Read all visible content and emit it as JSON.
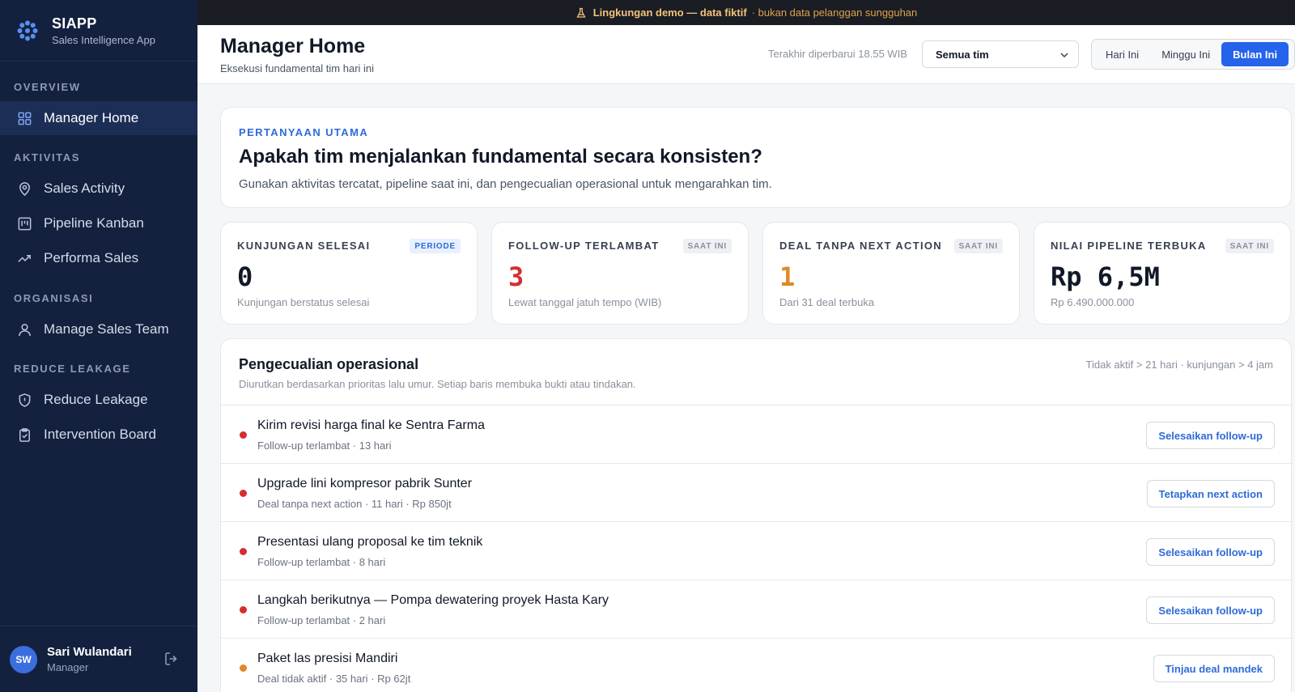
{
  "banner": {
    "strong": "Lingkungan demo — data fiktif",
    "soft": "· bukan data pelanggan sungguhan",
    "icon": "flask-icon",
    "color": "#f4c27a"
  },
  "brand": {
    "name": "SIAPP",
    "subtitle": "Sales Intelligence App",
    "icon": "logo-dots-icon"
  },
  "sidebar": {
    "sections": [
      {
        "title": "OVERVIEW"
      },
      {
        "title": "AKTIVITAS"
      },
      {
        "title": "ORGANISASI"
      },
      {
        "title": "REDUCE LEAKAGE"
      }
    ],
    "items": [
      {
        "label": "Manager Home",
        "icon": "grid-icon",
        "active": true
      },
      {
        "label": "Sales Activity",
        "icon": "map-pin-icon"
      },
      {
        "label": "Pipeline Kanban",
        "icon": "kanban-icon"
      },
      {
        "label": "Performa Sales",
        "icon": "trending-up-icon"
      },
      {
        "label": "Manage Sales Team",
        "icon": "user-icon"
      },
      {
        "label": "Reduce Leakage",
        "icon": "shield-icon"
      },
      {
        "label": "Intervention Board",
        "icon": "clipboard-icon"
      }
    ]
  },
  "user": {
    "initials": "SW",
    "name": "Sari Wulandari",
    "role": "Manager"
  },
  "header": {
    "title": "Manager Home",
    "subtitle": "Eksekusi fundamental tim hari ini",
    "updated": "Terakhir diperbarui 18.55 WIB",
    "team_select": "Semua tim",
    "periods": [
      {
        "label": "Hari Ini",
        "active": false
      },
      {
        "label": "Minggu Ini",
        "active": false
      },
      {
        "label": "Bulan Ini",
        "active": true
      }
    ]
  },
  "question": {
    "eyebrow": "PERTANYAAN UTAMA",
    "title": "Apakah tim menjalankan fundamental secara konsisten?",
    "subtitle": "Gunakan aktivitas tercatat, pipeline saat ini, dan pengecualian operasional untuk mengarahkan tim."
  },
  "kpis": [
    {
      "label": "KUNJUNGAN SELESAI",
      "badge": "PERIODE",
      "value": "0",
      "note": "Kunjungan berstatus selesai",
      "color": "#111827"
    },
    {
      "label": "FOLLOW-UP TERLAMBAT",
      "badge": "SAAT INI",
      "value": "3",
      "note": "Lewat tanggal jatuh tempo (WIB)",
      "color": "#d32f2f"
    },
    {
      "label": "DEAL TANPA NEXT ACTION",
      "badge": "SAAT INI",
      "value": "1",
      "note": "Dari 31 deal terbuka",
      "color": "#e0892a"
    },
    {
      "label": "NILAI PIPELINE TERBUKA",
      "badge": "SAAT INI",
      "value": "Rp 6,5M",
      "note": "Rp 6.490.000.000",
      "color": "#111827"
    }
  ],
  "exceptions": {
    "title": "Pengecualian operasional",
    "subtitle": "Diurutkan berdasarkan prioritas lalu umur. Setiap baris membuka bukti atau tindakan.",
    "filter": "Tidak aktif > 21 hari · kunjungan > 4 jam",
    "rows": [
      {
        "title": "Kirim revisi harga final ke Sentra Farma",
        "meta": "Follow-up terlambat · 13 hari",
        "action": "Selesaikan follow-up",
        "color": "#d32f2f"
      },
      {
        "title": "Upgrade lini kompresor pabrik Sunter",
        "meta": "Deal tanpa next action · 11 hari · Rp 850jt",
        "action": "Tetapkan next action",
        "color": "#d32f2f"
      },
      {
        "title": "Presentasi ulang proposal ke tim teknik",
        "meta": "Follow-up terlambat · 8 hari",
        "action": "Selesaikan follow-up",
        "color": "#d32f2f"
      },
      {
        "title": "Langkah berikutnya — Pompa dewatering proyek Hasta Kary",
        "meta": "Follow-up terlambat · 2 hari",
        "action": "Selesaikan follow-up",
        "color": "#d32f2f"
      },
      {
        "title": "Paket las presisi Mandiri",
        "meta": "Deal tidak aktif · 35 hari · Rp 62jt",
        "action": "Tinjau deal mandek",
        "color": "#e0892a"
      }
    ]
  }
}
